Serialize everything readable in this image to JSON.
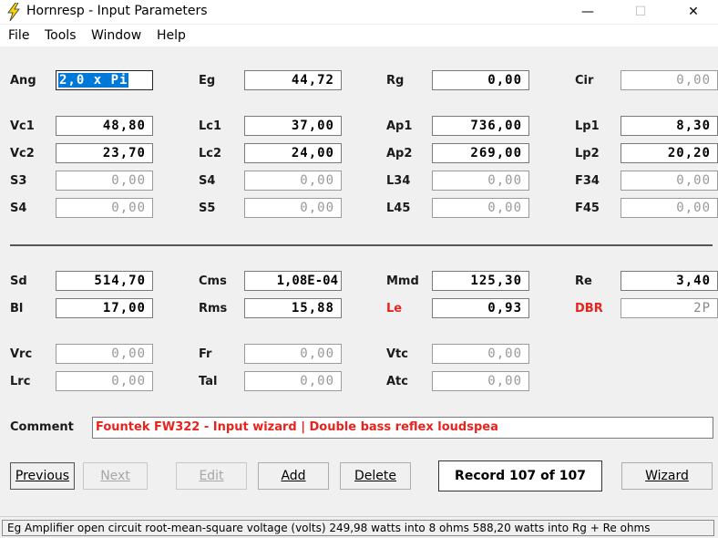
{
  "window": {
    "title": "Hornresp - Input Parameters",
    "minimize": "—",
    "maximize": "☐",
    "close": "✕"
  },
  "menu": [
    "File",
    "Tools",
    "Window",
    "Help"
  ],
  "params": {
    "Ang": "2,0 x Pi",
    "Eg": "44,72",
    "Rg": "0,00",
    "Cir": "0,00",
    "Vc1": "48,80",
    "Lc1": "37,00",
    "Ap1": "736,00",
    "Lp1": "8,30",
    "Vc2": "23,70",
    "Lc2": "24,00",
    "Ap2": "269,00",
    "Lp2": "20,20",
    "S3": "0,00",
    "S4a": "0,00",
    "L34": "0,00",
    "F34": "0,00",
    "S4": "0,00",
    "S5": "0,00",
    "L45": "0,00",
    "F45": "0,00",
    "Sd": "514,70",
    "Cms": "1,08E-04",
    "Mmd": "125,30",
    "Re": "3,40",
    "Bl": "17,00",
    "Rms": "15,88",
    "Le": "0,93",
    "DBR": "2P",
    "Vrc": "0,00",
    "Fr": "0,00",
    "Vtc": "0,00",
    "Lrc": "0,00",
    "Tal": "0,00",
    "Atc": "0,00"
  },
  "labels": {
    "Ang": "Ang",
    "Eg": "Eg",
    "Rg": "Rg",
    "Cir": "Cir",
    "Vc1": "Vc1",
    "Lc1": "Lc1",
    "Ap1": "Ap1",
    "Lp1": "Lp1",
    "Vc2": "Vc2",
    "Lc2": "Lc2",
    "Ap2": "Ap2",
    "Lp2": "Lp2",
    "S3": "S3",
    "S4a": "S4",
    "L34": "L34",
    "F34": "F34",
    "S4": "S4",
    "S5": "S5",
    "L45": "L45",
    "F45": "F45",
    "Sd": "Sd",
    "Cms": "Cms",
    "Mmd": "Mmd",
    "Re": "Re",
    "Bl": "Bl",
    "Rms": "Rms",
    "Le": "Le",
    "DBR": "DBR",
    "Vrc": "Vrc",
    "Fr": "Fr",
    "Vtc": "Vtc",
    "Lrc": "Lrc",
    "Tal": "Tal",
    "Atc": "Atc",
    "Comment": "Comment"
  },
  "comment": "Fountek FW322 - Input wizard | Double bass reflex loudspea",
  "buttons": {
    "previous": "Previous",
    "next": "Next",
    "edit": "Edit",
    "add": "Add",
    "delete": "Delete",
    "wizard": "Wizard"
  },
  "record": "Record 107 of 107",
  "status": "Eg  Amplifier open circuit root-mean-square voltage  (volts)  249,98 watts into 8 ohms   588,20 watts into Rg + Re ohms",
  "colors": {
    "highlight_label": "#e8231d",
    "selection": "#0078d7"
  }
}
